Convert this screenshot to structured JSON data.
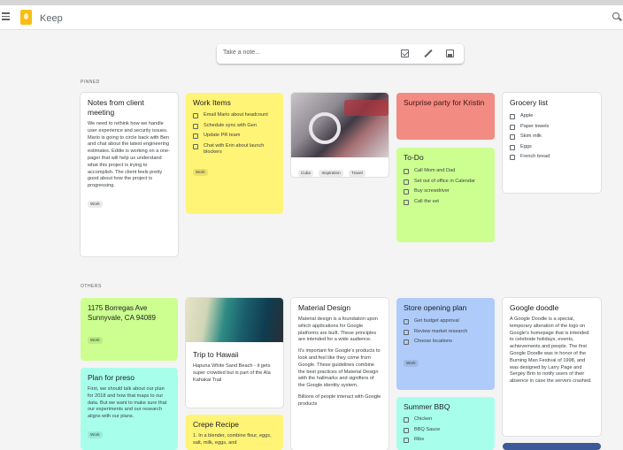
{
  "app": {
    "title": "Keep"
  },
  "take_note": {
    "placeholder": "Take a note..."
  },
  "sections": {
    "pinned": "PINNED",
    "others": "OTHERS"
  },
  "notes": {
    "client_meeting": {
      "title": "Notes from client meeting",
      "body": "We need to rethink how we handle user experience and security issues. Mario is going to circle back with Ben and chat about the latest engineering estimates. Eddie is working on a one-pager that will help us understand what this project is trying to accomplish. The client feels pretty good about how the project is progressing.",
      "label": "Work"
    },
    "work_items": {
      "title": "Work Items",
      "items": [
        "Email Mario about headcount",
        "Schedule sync with Gen",
        "Update PR team",
        "Chat with Erin about launch blockers"
      ],
      "label": "Work"
    },
    "car_photo": {
      "labels": [
        "Cuba",
        "Inspiration",
        "Travel"
      ]
    },
    "surprise_party": {
      "title": "Surprise party for Kristin"
    },
    "todo": {
      "title": "To-Do",
      "items": [
        "Call Mom and Dad",
        "Set out of office in Calendar",
        "Buy screwdriver",
        "Call the vet"
      ]
    },
    "grocery": {
      "title": "Grocery list",
      "items": [
        "Apple",
        "Paper towels",
        "Skim milk",
        "Eggs",
        "French bread"
      ]
    },
    "address": {
      "title": "1175 Borregas Ave Sunnyvale, CA 94089",
      "label": "Work"
    },
    "plan_for_preso": {
      "title": "Plan for preso",
      "body": "First, we should talk about our plan for 2018 and how that maps to our data. But we want to make sure that our experiments and our research aligns with our plans.",
      "label": "Work"
    },
    "hawaii": {
      "title": "Trip to Hawaii",
      "body": "Hapuna White Sand Beach - it gets super crowded but is part of the Ala Kahakai Trail"
    },
    "crepe": {
      "title": "Crepe Recipe",
      "body": "1. In a blender, combine flour, eggs, salt, milk, eggs, and"
    },
    "material": {
      "title": "Material Design",
      "body1": "Material design is a foundation upon which applications for Google platforms are built. These principles are intended for a wide audience.",
      "body2": "It's important for Google's products to look and feel like they come from Google. These guidelines combine the best practices of Material Design with the hallmarks and signifiers of the Google identity system.",
      "body3": "Billions of people interact with Google products"
    },
    "store_opening": {
      "title": "Store opening plan",
      "items": [
        "Get budget approval",
        "Review market research",
        "Choose locations"
      ],
      "label": "Work"
    },
    "summer_bbq": {
      "title": "Summer BBQ",
      "items": [
        "Chicken",
        "BBQ Sauce",
        "Ribs"
      ]
    },
    "google_doodle": {
      "title": "Google doodle",
      "body": "A Google Doodle is a special, temporary alteration of the logo on Google's homepage that is intended to celebrate holidays, events, achievements and people. The first Google Doodle was in honor of the Burning Man Festival of 1998, and was designed by Larry Page and Sergey Brin to notify users of their absence in case the servers crashed."
    }
  },
  "colors": {
    "yellow": "#fff475",
    "red": "#f28b82",
    "green": "#ccff90",
    "teal": "#a7ffeb",
    "blue": "#aecbfa",
    "keep_logo": "#f9bd16"
  },
  "icons": [
    "menu-icon",
    "keep-logo-icon",
    "search-icon",
    "checkbox-icon",
    "pen-icon",
    "image-icon"
  ]
}
